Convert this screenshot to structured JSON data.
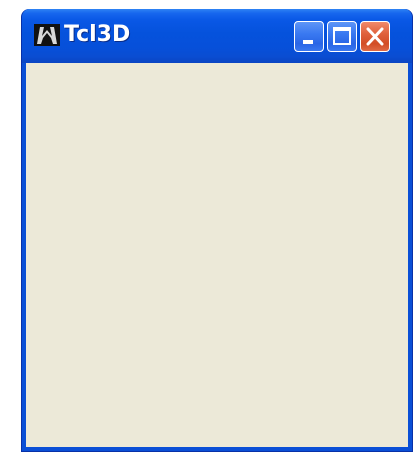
{
  "window": {
    "title": "Tcl3D",
    "app_icon": "tcl3d-app-icon",
    "controls": {
      "minimize_icon": "minimize-icon",
      "maximize_icon": "maximize-icon",
      "close_icon": "close-icon"
    }
  },
  "colors": {
    "titlebar": "#0552dc",
    "frame": "#0a4fd6",
    "client_background": "#ece9d8",
    "close_button": "#e0613c"
  }
}
